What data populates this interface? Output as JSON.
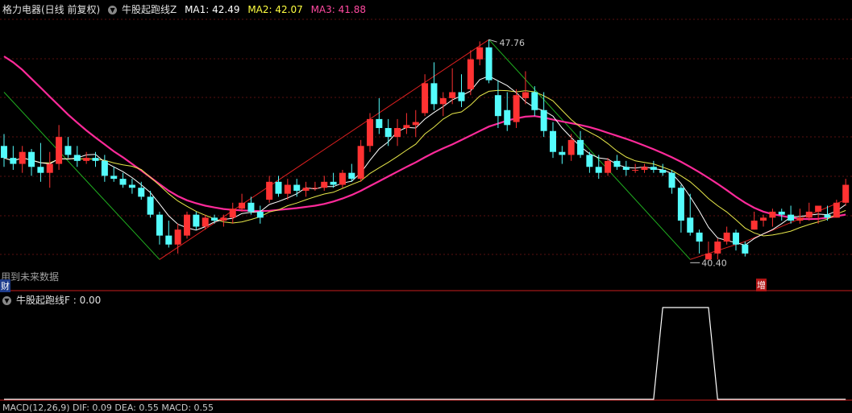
{
  "main_panel": {
    "stock_name": "格力电器(日线 前复权)",
    "indicator_name": "牛股起跑线Z",
    "ma1_label": "MA1: 42.49",
    "ma2_label": "MA2: 42.07",
    "ma3_label": "MA3: 41.88",
    "watermark": "用到未来数据",
    "cai_badge": "财",
    "zeng_badge": "增",
    "high_label": "47.76",
    "low_label": "40.40"
  },
  "sub_panel": {
    "indicator_label": "牛股起跑线F : 0.00"
  },
  "bottom_panel": {
    "text": "MACD(12,26,9) DIF: 0.09 DEA: 0.55 MACD: 0.55"
  },
  "colors": {
    "up": "#ff3232",
    "down": "#54fcfc",
    "ma1": "#ffffff",
    "ma2": "#e8e84a",
    "ma3": "#ff2a9a",
    "zig_up": "#e02020",
    "zig_down": "#20b020",
    "ma1_label": "#ffffff",
    "ma2_label": "#ffff40",
    "ma3_label": "#ff4aa0",
    "divider": "#c81e1e"
  },
  "chart_data": {
    "type": "candlestick",
    "ylim": [
      39.6,
      48.6
    ],
    "high_point": 47.76,
    "low_point": 40.4,
    "candles": [
      [
        44.2,
        44.6,
        43.5,
        43.8
      ],
      [
        43.8,
        44.2,
        43.4,
        43.6
      ],
      [
        43.6,
        44.2,
        43.3,
        44.0
      ],
      [
        44.0,
        44.1,
        43.2,
        43.5
      ],
      [
        43.5,
        44.3,
        43.0,
        43.3
      ],
      [
        43.3,
        44.0,
        42.8,
        43.6
      ],
      [
        43.6,
        44.9,
        43.4,
        44.5
      ],
      [
        44.2,
        44.5,
        43.8,
        43.9
      ],
      [
        43.9,
        44.2,
        43.5,
        43.7
      ],
      [
        43.7,
        44.0,
        43.6,
        43.8
      ],
      [
        43.8,
        44.0,
        43.5,
        43.7
      ],
      [
        43.7,
        43.9,
        43.0,
        43.2
      ],
      [
        43.2,
        43.5,
        43.0,
        43.1
      ],
      [
        43.1,
        43.3,
        42.8,
        42.9
      ],
      [
        42.9,
        43.1,
        42.6,
        42.8
      ],
      [
        42.8,
        43.0,
        42.4,
        42.5
      ],
      [
        42.5,
        42.7,
        41.8,
        41.9
      ],
      [
        41.9,
        42.0,
        40.9,
        41.2
      ],
      [
        41.2,
        41.7,
        40.8,
        40.9
      ],
      [
        40.9,
        41.6,
        40.6,
        41.4
      ],
      [
        41.2,
        42.0,
        41.1,
        41.9
      ],
      [
        41.9,
        42.0,
        41.4,
        41.5
      ],
      [
        41.5,
        41.9,
        41.4,
        41.8
      ],
      [
        41.8,
        41.9,
        41.6,
        41.7
      ],
      [
        41.7,
        41.9,
        41.5,
        41.8
      ],
      [
        41.8,
        42.3,
        41.6,
        42.1
      ],
      [
        42.1,
        42.6,
        42.0,
        42.3
      ],
      [
        42.3,
        42.5,
        41.9,
        42.0
      ],
      [
        42.0,
        42.2,
        41.6,
        41.8
      ],
      [
        42.4,
        43.2,
        42.3,
        43.0
      ],
      [
        43.0,
        43.2,
        42.5,
        42.6
      ],
      [
        42.6,
        43.1,
        42.4,
        42.9
      ],
      [
        42.9,
        43.1,
        42.5,
        42.7
      ],
      [
        42.7,
        43.0,
        42.5,
        42.8
      ],
      [
        42.8,
        43.0,
        42.7,
        42.8
      ],
      [
        42.8,
        43.2,
        42.7,
        43.0
      ],
      [
        43.0,
        43.3,
        42.8,
        42.9
      ],
      [
        42.9,
        43.4,
        42.8,
        43.3
      ],
      [
        43.3,
        43.6,
        43.0,
        43.1
      ],
      [
        43.1,
        44.4,
        43.0,
        44.2
      ],
      [
        44.2,
        45.3,
        44.0,
        45.1
      ],
      [
        45.1,
        45.8,
        44.6,
        44.8
      ],
      [
        44.8,
        45.1,
        44.2,
        44.5
      ],
      [
        44.5,
        45.1,
        44.2,
        44.8
      ],
      [
        44.8,
        45.3,
        44.6,
        44.9
      ],
      [
        44.9,
        45.4,
        44.5,
        45.0
      ],
      [
        45.3,
        46.6,
        45.2,
        46.3
      ],
      [
        46.3,
        47.0,
        45.4,
        45.6
      ],
      [
        45.6,
        46.0,
        45.2,
        45.8
      ],
      [
        45.8,
        46.8,
        45.6,
        46.0
      ],
      [
        46.0,
        46.6,
        45.5,
        45.7
      ],
      [
        46.1,
        47.4,
        45.9,
        47.1
      ],
      [
        47.1,
        47.7,
        46.9,
        47.5
      ],
      [
        47.5,
        47.76,
        46.3,
        46.4
      ],
      [
        45.9,
        46.4,
        44.8,
        45.2
      ],
      [
        45.4,
        46.0,
        44.7,
        44.9
      ],
      [
        45.0,
        46.1,
        44.8,
        45.9
      ],
      [
        45.8,
        46.7,
        45.6,
        46.0
      ],
      [
        46.0,
        46.2,
        45.2,
        45.4
      ],
      [
        45.4,
        46.0,
        44.5,
        44.7
      ],
      [
        44.7,
        45.0,
        43.8,
        44.0
      ],
      [
        44.0,
        44.2,
        43.6,
        43.9
      ],
      [
        43.9,
        44.6,
        43.7,
        44.4
      ],
      [
        44.4,
        44.7,
        43.8,
        43.9
      ],
      [
        43.9,
        44.0,
        43.3,
        43.5
      ],
      [
        43.5,
        43.9,
        43.1,
        43.3
      ],
      [
        43.3,
        43.8,
        43.2,
        43.7
      ],
      [
        43.7,
        43.9,
        43.4,
        43.5
      ],
      [
        43.5,
        43.7,
        43.2,
        43.4
      ],
      [
        43.4,
        43.6,
        43.3,
        43.4
      ],
      [
        43.4,
        43.6,
        43.3,
        43.5
      ],
      [
        43.5,
        43.7,
        43.3,
        43.4
      ],
      [
        43.4,
        43.6,
        43.2,
        43.3
      ],
      [
        43.3,
        43.4,
        42.6,
        42.8
      ],
      [
        42.8,
        42.9,
        41.3,
        41.7
      ],
      [
        41.8,
        42.6,
        41.2,
        41.3
      ],
      [
        41.3,
        41.4,
        40.6,
        41.0
      ],
      [
        40.4,
        41.0,
        40.4,
        40.6
      ],
      [
        40.6,
        41.1,
        40.4,
        41.0
      ],
      [
        41.0,
        41.5,
        40.9,
        41.3
      ],
      [
        41.3,
        41.4,
        40.7,
        40.9
      ],
      [
        40.9,
        41.0,
        40.5,
        40.6
      ],
      [
        41.4,
        42.0,
        41.4,
        41.7
      ],
      [
        41.7,
        41.9,
        41.5,
        41.8
      ],
      [
        41.8,
        42.1,
        41.5,
        42.0
      ],
      [
        42.0,
        42.1,
        41.7,
        41.9
      ],
      [
        41.9,
        42.2,
        41.6,
        41.7
      ],
      [
        41.7,
        42.1,
        41.6,
        41.8
      ],
      [
        41.8,
        42.3,
        41.7,
        42.0
      ],
      [
        42.0,
        42.1,
        41.6,
        42.2
      ],
      [
        41.9,
        42.2,
        41.7,
        41.8
      ],
      [
        41.8,
        42.4,
        41.8,
        42.3
      ],
      [
        42.3,
        43.1,
        42.2,
        42.9
      ]
    ],
    "ma3": [
      47.2,
      47.0,
      46.75,
      46.45,
      46.15,
      45.85,
      45.55,
      45.25,
      44.98,
      44.72,
      44.48,
      44.25,
      44.02,
      43.82,
      43.6,
      43.38,
      43.15,
      42.92,
      42.7,
      42.52,
      42.38,
      42.28,
      42.2,
      42.14,
      42.09,
      42.06,
      42.04,
      42.03,
      42.02,
      42.03,
      42.06,
      42.09,
      42.12,
      42.16,
      42.2,
      42.26,
      42.34,
      42.44,
      42.56,
      42.7,
      42.86,
      43.02,
      43.18,
      43.34,
      43.5,
      43.65,
      43.82,
      43.98,
      44.12,
      44.25,
      44.4,
      44.55,
      44.7,
      44.85,
      44.95,
      45.05,
      45.12,
      45.18,
      45.2,
      45.15,
      45.08,
      45.02,
      44.96,
      44.9,
      44.83,
      44.74,
      44.64,
      44.54,
      44.44,
      44.33,
      44.21,
      44.09,
      43.96,
      43.82,
      43.67,
      43.5,
      43.32,
      43.13,
      42.93,
      42.72,
      42.5,
      42.3,
      42.13,
      42.0,
      41.92,
      41.86,
      41.8,
      41.76,
      41.75,
      41.76,
      41.8,
      41.85,
      41.9
    ],
    "zigzag": [
      [
        0,
        46.0
      ],
      [
        17,
        40.4
      ],
      [
        53,
        47.76
      ],
      [
        75,
        40.4
      ],
      [
        81,
        41.0
      ],
      [
        92,
        42.4
      ]
    ],
    "signal_f": [
      [
        0,
        0
      ],
      [
        71,
        0
      ],
      [
        72,
        1
      ],
      [
        77,
        1
      ],
      [
        78,
        0
      ],
      [
        92,
        0
      ]
    ]
  }
}
